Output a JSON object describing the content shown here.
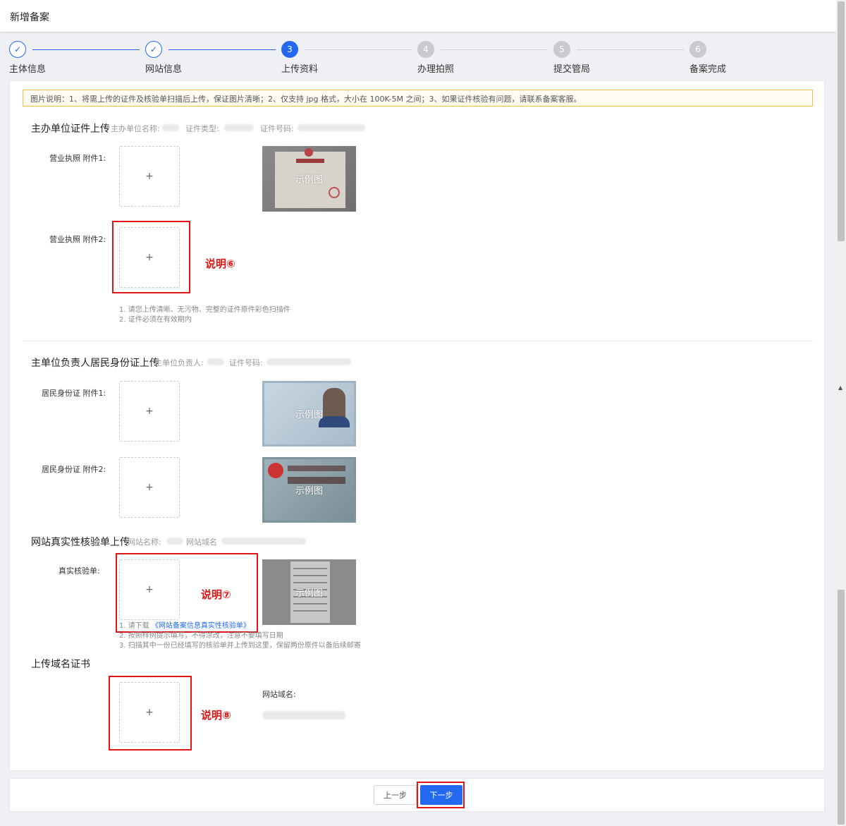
{
  "page": {
    "title": "新增备案"
  },
  "steps": [
    {
      "num": "✓",
      "label": "主体信息",
      "state": "done"
    },
    {
      "num": "✓",
      "label": "网站信息",
      "state": "done"
    },
    {
      "num": "3",
      "label": "上传资料",
      "state": "active"
    },
    {
      "num": "4",
      "label": "办理拍照",
      "state": "todo"
    },
    {
      "num": "5",
      "label": "提交管局",
      "state": "todo"
    },
    {
      "num": "6",
      "label": "备案完成",
      "state": "todo"
    }
  ],
  "notice": "图片说明：1、将需上传的证件及核验单扫描后上传，保证图片清晰；2、仅支持 jpg 格式，大小在 100K-5M 之间；3、如果证件核验有问题，请联系备案客服。",
  "org_section": {
    "title": "主办单位证件上传",
    "meta_name": "主办单位名称:",
    "meta_type": "证件类型:",
    "meta_no": "证件号码:",
    "field1": "营业执照 附件1:",
    "field2": "营业执照 附件2:",
    "example": "示例图",
    "annotation": "说明⑥",
    "hints": [
      "1. 请您上传清晰、无污物、完整的证件原件彩色扫描件",
      "2. 证件必须在有效期内"
    ]
  },
  "person_section": {
    "title": "主单位负责人居民身份证上传",
    "meta_name": "主单位负责人:",
    "meta_no": "证件号码:",
    "field1": "居民身份证 附件1:",
    "field2": "居民身份证 附件2:",
    "example": "示例图"
  },
  "verify_section": {
    "title": "网站真实性核验单上传",
    "meta_site": "网站名称:",
    "meta_domain": "网站域名",
    "field": "真实核验单:",
    "example": "示例图",
    "annotation": "说明⑦",
    "hint1_prefix": "1. 请下载",
    "hint1_link": "《网站备案信息真实性核验单》",
    "hint2": "2. 按照样例提示填写，不得涂改，注意不要填写日期",
    "hint3": "3. 扫描其中一份已经填写的核验单并上传到这里，保留两份原件以备后续邮寄"
  },
  "domain_section": {
    "title": "上传域名证书",
    "domain_label": "网站域名:",
    "annotation": "说明⑧"
  },
  "upload_plus": "+",
  "footer": {
    "prev": "上一步",
    "next": "下一步"
  },
  "colors": {
    "primary": "#2468f2",
    "annotation": "#e01515",
    "notice_border": "#f5c04a"
  }
}
